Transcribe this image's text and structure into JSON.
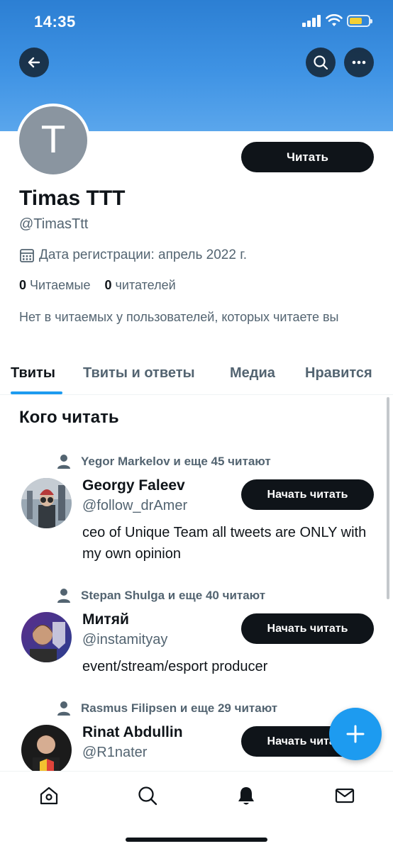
{
  "status_bar": {
    "time": "14:35"
  },
  "profile": {
    "avatar_letter": "T",
    "name": "Timas TTT",
    "handle": "@TimasTtt",
    "joined": "Дата регистрации: апрель 2022 г.",
    "following_count": "0",
    "following_label": "Читаемые",
    "followers_count": "0",
    "followers_label": "читателей",
    "bio": "Нет в читаемых у пользователей, которых читаете вы",
    "follow_button": "Читать"
  },
  "tabs": [
    {
      "label": "Твиты",
      "active": true
    },
    {
      "label": "Твиты и ответы",
      "active": false
    },
    {
      "label": "Медиа",
      "active": false
    },
    {
      "label": "Нравится",
      "active": false
    }
  ],
  "who_to_follow": {
    "title": "Кого читать",
    "items": [
      {
        "context": "Yegor Markelov и еще 45 читают",
        "name": "Georgy Faleev",
        "handle": "@follow_drAmer",
        "bio": "ceo of Unique Team all tweets are ONLY with my own opinion",
        "button": "Начать читать"
      },
      {
        "context": "Stepan Shulga и еще 40 читают",
        "name": "Митяй",
        "handle": "@instamityay",
        "bio": "event/stream/esport producer",
        "button": "Начать читать"
      },
      {
        "context": "Rasmus Filipsen и еще 29 читают",
        "name": "Rinat Abdullin",
        "handle": "@R1nater",
        "bio": "",
        "button": "Начать читать"
      }
    ]
  },
  "bottom_nav": [
    "home-icon",
    "search-icon",
    "notifications-icon",
    "messages-icon"
  ],
  "colors": {
    "accent": "#1d9bf0",
    "banner": "#3f93e4",
    "text": "#0f1419",
    "secondary": "#536471"
  }
}
